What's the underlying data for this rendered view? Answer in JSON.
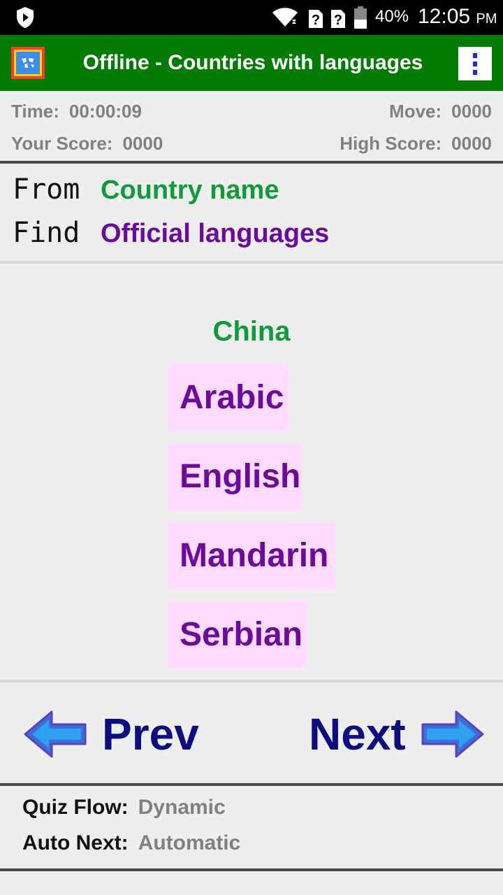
{
  "status_bar": {
    "battery_percent": "40%",
    "time": "12:05",
    "ampm": "PM",
    "icons": [
      "shield-icon",
      "wifi-icon",
      "sim-unknown-icon",
      "sim-unknown-icon",
      "battery-icon"
    ]
  },
  "app_bar": {
    "title": "Offline - Countries with languages",
    "logo_icon": "world-map-icon",
    "menu_icon": "overflow-menu-icon",
    "color": "#047c04"
  },
  "stats": {
    "time_label": "Time:",
    "time_value": "00:00:09",
    "move_label": "Move:",
    "move_value": "0000",
    "score_label": "Your Score:",
    "score_value": "0000",
    "high_label": "High Score:",
    "high_value": "0000"
  },
  "mode": {
    "from_label": "From",
    "from_value": "Country name",
    "find_label": "Find",
    "find_value": "Official languages"
  },
  "quiz": {
    "question": "China",
    "options": [
      "Arabic",
      "English",
      "Mandarin",
      "Serbian"
    ]
  },
  "nav": {
    "prev_label": "Prev",
    "next_label": "Next",
    "prev_icon": "arrow-left-icon",
    "next_icon": "arrow-right-icon"
  },
  "settings": {
    "flow_label": "Quiz Flow:",
    "flow_value": "Dynamic",
    "auto_label": "Auto Next:",
    "auto_value": "Automatic"
  },
  "colors": {
    "green": "#109a3c",
    "purple": "#6c0a9c",
    "option_bg": "#ffdcff",
    "nav_text": "#0d0d80",
    "arrow": "#3b6fd6"
  }
}
